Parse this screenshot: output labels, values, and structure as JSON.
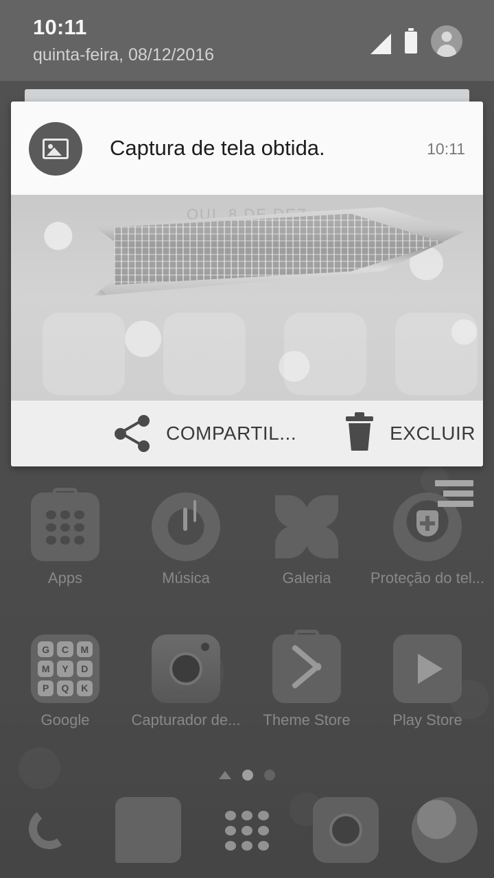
{
  "status_bar": {
    "time": "10:11",
    "date": "quinta-feira, 08/12/2016",
    "icons": [
      "signal-icon",
      "battery-icon",
      "account-avatar-icon"
    ]
  },
  "notification": {
    "thumb_icon": "image-icon",
    "title": "Captura de tela obtida.",
    "time": "10:11",
    "preview_date_label": "QUI, 8 DE DEZ",
    "actions": [
      {
        "icon": "share-icon",
        "label": "COMPARTIL..."
      },
      {
        "icon": "trash-icon",
        "label": "EXCLUIR"
      }
    ]
  },
  "home": {
    "row1": [
      {
        "label": "Apps",
        "icon": "apps-drawer-icon"
      },
      {
        "label": "Música",
        "icon": "music-icon"
      },
      {
        "label": "Galeria",
        "icon": "gallery-icon"
      },
      {
        "label": "Proteção do tel...",
        "icon": "phone-protection-icon"
      }
    ],
    "row2": [
      {
        "label": "Google",
        "icon": "google-folder-icon"
      },
      {
        "label": "Capturador de...",
        "icon": "screen-capture-icon"
      },
      {
        "label": "Theme Store",
        "icon": "theme-store-icon"
      },
      {
        "label": "Play Store",
        "icon": "play-store-icon"
      }
    ],
    "google_folder_letters": [
      "G",
      "C",
      "M",
      "M",
      "Y",
      "D",
      "P",
      "Q",
      "K"
    ],
    "page_indicator": {
      "pages": 2,
      "active": 0,
      "has_up_arrow": true
    },
    "dock": [
      {
        "icon": "phone-icon"
      },
      {
        "icon": "messages-icon"
      },
      {
        "icon": "app-drawer-icon"
      },
      {
        "icon": "camera-icon"
      },
      {
        "icon": "browser-icon"
      }
    ]
  },
  "colors": {
    "statusbar_bg": "#646464",
    "notification_bg": "#fafafa",
    "action_bar_bg": "#ededed",
    "label_text": "#c3c3c3",
    "title_text": "#1d1d1d"
  }
}
